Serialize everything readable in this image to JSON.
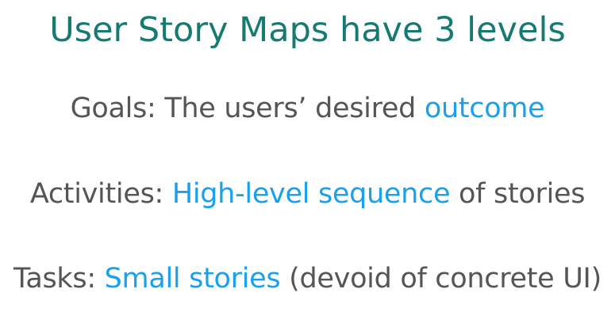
{
  "slide": {
    "title": "User Story Maps have 3 levels",
    "colors": {
      "title": "#157a72",
      "body_text": "#555555",
      "highlight": "#1aa0ec"
    },
    "levels": [
      {
        "prefix": "Goals: The users’ desired ",
        "highlight": "outcome",
        "suffix": ""
      },
      {
        "prefix": "Activities: ",
        "highlight": "High-level sequence",
        "suffix": " of stories"
      },
      {
        "prefix": "Tasks: ",
        "highlight": "Small stories",
        "suffix": " (devoid of concrete UI)"
      }
    ]
  }
}
